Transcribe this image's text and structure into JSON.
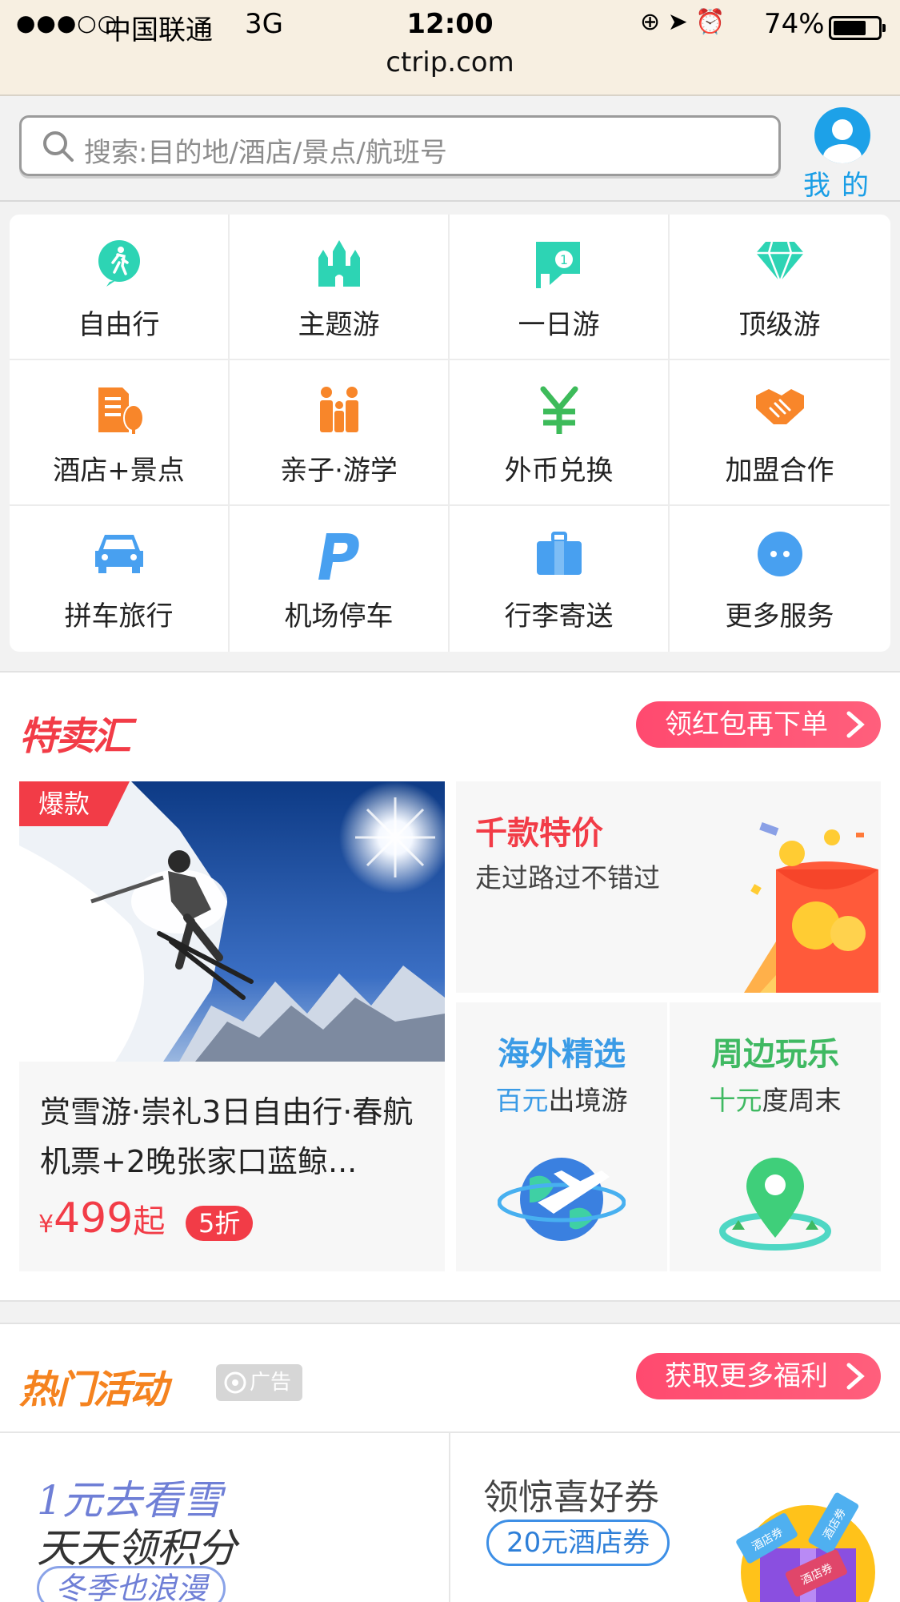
{
  "status_bar": {
    "signal": "●●●○○",
    "carrier": "中国联通",
    "network": "3G",
    "time": "12:00",
    "icons": "⊕ ➤ ⏰",
    "battery_percent": "74%",
    "battery_level": 0.74,
    "url": "ctrip.com"
  },
  "search": {
    "placeholder": "搜索:目的地/酒店/景点/航班号",
    "mine_label": "我的"
  },
  "services": [
    {
      "label": "自由行",
      "icon": "hiker-icon",
      "color": "#2dd4b4"
    },
    {
      "label": "主题游",
      "icon": "castle-icon",
      "color": "#2dd4b4"
    },
    {
      "label": "一日游",
      "icon": "flag-one-icon",
      "color": "#2dd4b4"
    },
    {
      "label": "顶级游",
      "icon": "diamond-icon",
      "color": "#2dd4b4"
    },
    {
      "label": "酒店+景点",
      "icon": "hotel-tree-icon",
      "color": "#f8862a"
    },
    {
      "label": "亲子·游学",
      "icon": "family-icon",
      "color": "#f8862a"
    },
    {
      "label": "外币兑换",
      "icon": "yen-icon",
      "color": "#3dbb5a"
    },
    {
      "label": "加盟合作",
      "icon": "handshake-icon",
      "color": "#f8862a"
    },
    {
      "label": "拼车旅行",
      "icon": "car-icon",
      "color": "#48a0f0"
    },
    {
      "label": "机场停车",
      "icon": "parking-icon",
      "color": "#48a0f0"
    },
    {
      "label": "行李寄送",
      "icon": "luggage-icon",
      "color": "#48a0f0"
    },
    {
      "label": "更多服务",
      "icon": "more-icon",
      "color": "#48a0f0"
    }
  ],
  "flash_sale": {
    "logo": "特卖汇",
    "button": "领红包再下单",
    "deal": {
      "badge": "爆款",
      "title": "赏雪游·崇礼3日自由行·春航机票+2晚张家口蓝鲸...",
      "currency": "¥",
      "price": "499",
      "price_suffix": "起",
      "discount": "5折"
    },
    "promo_big": {
      "title": "千款特价",
      "subtitle": "走过路过不错过"
    },
    "promo_overseas": {
      "title": "海外精选",
      "sub_highlight": "百元",
      "sub_rest": "出境游",
      "color": "#3a9be6"
    },
    "promo_nearby": {
      "title": "周边玩乐",
      "sub_highlight": "十元",
      "sub_rest": "度周末",
      "color": "#3fb962"
    }
  },
  "hot_activities": {
    "logo": "热门活动",
    "ad_label": "广告",
    "button": "获取更多福利",
    "left": {
      "line1": "1元去看雪",
      "line2": "天天领积分",
      "line3": "冬季也浪漫"
    },
    "right": {
      "line1": "领惊喜好券",
      "coupon": "20元酒店券",
      "stamp1": "酒店券",
      "stamp2": "酒店券",
      "stamp3": "酒店券"
    }
  },
  "colors": {
    "accent_red": "#f23c47",
    "pill_pink": "#ff4a6f",
    "link_blue": "#1a9ee6",
    "header_bg": "#f7efe1"
  }
}
